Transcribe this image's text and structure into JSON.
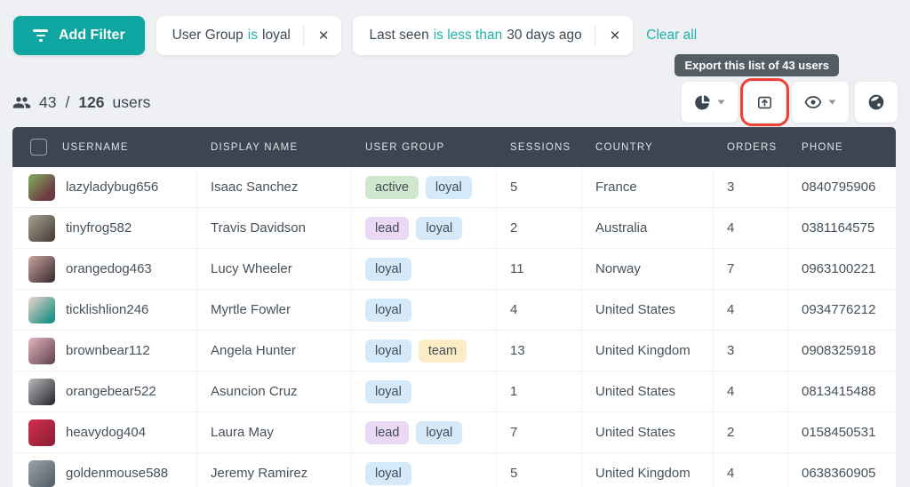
{
  "filter_bar": {
    "add_filter_label": "Add Filter",
    "filters": [
      {
        "field": "User Group",
        "operator": "is",
        "value": "loyal"
      },
      {
        "field": "Last seen",
        "operator": "is less than",
        "value": "30 days ago"
      }
    ],
    "close_glyph": "✕",
    "clear_all_label": "Clear all"
  },
  "summary": {
    "filtered": "43",
    "separator": "/",
    "total": "126",
    "suffix": "users"
  },
  "tooltip": {
    "text": "Export this list of 43 users"
  },
  "toolbar": {
    "buttons": [
      {
        "icon": "pie-chart-icon",
        "has_caret": true
      },
      {
        "icon": "export-icon",
        "has_caret": false,
        "annotated": true
      },
      {
        "icon": "eye-icon",
        "has_caret": true
      },
      {
        "icon": "globe-icon",
        "has_caret": false
      }
    ]
  },
  "table": {
    "columns": [
      "USERNAME",
      "DISPLAY NAME",
      "USER GROUP",
      "SESSIONS",
      "COUNTRY",
      "ORDERS",
      "PHONE"
    ],
    "rows": [
      {
        "username": "lazyladybug656",
        "display_name": "Isaac Sanchez",
        "tags": [
          "active",
          "loyal"
        ],
        "sessions": "5",
        "country": "France",
        "orders": "3",
        "phone": "0840795906"
      },
      {
        "username": "tinyfrog582",
        "display_name": "Travis Davidson",
        "tags": [
          "lead",
          "loyal"
        ],
        "sessions": "2",
        "country": "Australia",
        "orders": "4",
        "phone": "0381164575"
      },
      {
        "username": "orangedog463",
        "display_name": "Lucy Wheeler",
        "tags": [
          "loyal"
        ],
        "sessions": "11",
        "country": "Norway",
        "orders": "7",
        "phone": "0963100221"
      },
      {
        "username": "ticklishlion246",
        "display_name": "Myrtle Fowler",
        "tags": [
          "loyal"
        ],
        "sessions": "4",
        "country": "United States",
        "orders": "4",
        "phone": "0934776212"
      },
      {
        "username": "brownbear112",
        "display_name": "Angela Hunter",
        "tags": [
          "loyal",
          "team"
        ],
        "sessions": "13",
        "country": "United Kingdom",
        "orders": "3",
        "phone": "0908325918"
      },
      {
        "username": "orangebear522",
        "display_name": "Asuncion Cruz",
        "tags": [
          "loyal"
        ],
        "sessions": "1",
        "country": "United States",
        "orders": "4",
        "phone": "0813415488"
      },
      {
        "username": "heavydog404",
        "display_name": "Laura May",
        "tags": [
          "lead",
          "loyal"
        ],
        "sessions": "7",
        "country": "United States",
        "orders": "2",
        "phone": "0158450531"
      },
      {
        "username": "goldenmouse588",
        "display_name": "Jeremy Ramirez",
        "tags": [
          "loyal"
        ],
        "sessions": "5",
        "country": "United Kingdom",
        "orders": "4",
        "phone": "0638360905"
      }
    ]
  },
  "colors": {
    "accent_teal": "#0fa5a1",
    "teal_text": "#1fb1aa",
    "table_header_bg": "#3c4652",
    "tag_active": "#cfe8cd",
    "tag_loyal": "#d4eafa",
    "tag_lead": "#e9d8f6",
    "tag_team": "#fbecc6",
    "annotation_red": "#ee4134",
    "tooltip_bg": "#555d64"
  }
}
